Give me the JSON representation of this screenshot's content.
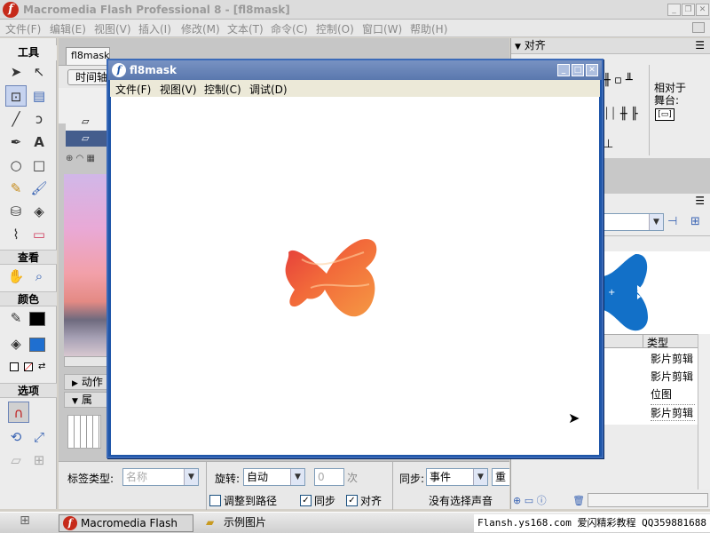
{
  "app": {
    "title": "Macromedia Flash Professional 8 - [fl8mask]",
    "menu": [
      "文件(F)",
      "编辑(E)",
      "视图(V)",
      "插入(I)",
      "修改(M)",
      "文本(T)",
      "命令(C)",
      "控制(O)",
      "窗口(W)",
      "帮助(H)"
    ]
  },
  "tools": {
    "sections": {
      "tools": "工具",
      "view": "查看",
      "colors": "颜色",
      "options": "选项"
    }
  },
  "document": {
    "tab": "fl8mask",
    "timeline_label": "时间轴",
    "actions_label": "动作",
    "props_label": "属"
  },
  "right_panel": {
    "align_title": "对齐",
    "relative_to": "相对于",
    "stage": "舞台:",
    "type_header": "类型",
    "library_items": [
      "影片剪辑",
      "影片剪辑",
      "位图",
      "影片剪辑"
    ]
  },
  "properties": {
    "label_type": "标签类型:",
    "name_placeholder": "名称",
    "rotate_label": "旋转:",
    "rotate_value": "自动",
    "times_value": "0",
    "times_unit": "次",
    "sync_label": "同步:",
    "sync_value": "事件",
    "repeat_short": "重",
    "adjust_path": "调整到路径",
    "sync_check": "同步",
    "snap_check": "对齐",
    "no_sound": "没有选择声音"
  },
  "movie_window": {
    "title": "fl8mask",
    "menu": [
      "文件(F)",
      "视图(V)",
      "控制(C)",
      "调试(D)"
    ]
  },
  "taskbar": {
    "task_flash": "Macromedia Flash Prof...",
    "task_folder": "示例图片",
    "tray_text": "Flansh.ys168.com 爱闪精彩教程 QQ359881688"
  },
  "colors": {
    "brand_red": "#c62a1a",
    "window_blue": "#1f56a8",
    "butterfly_blue": "#1270c8"
  }
}
